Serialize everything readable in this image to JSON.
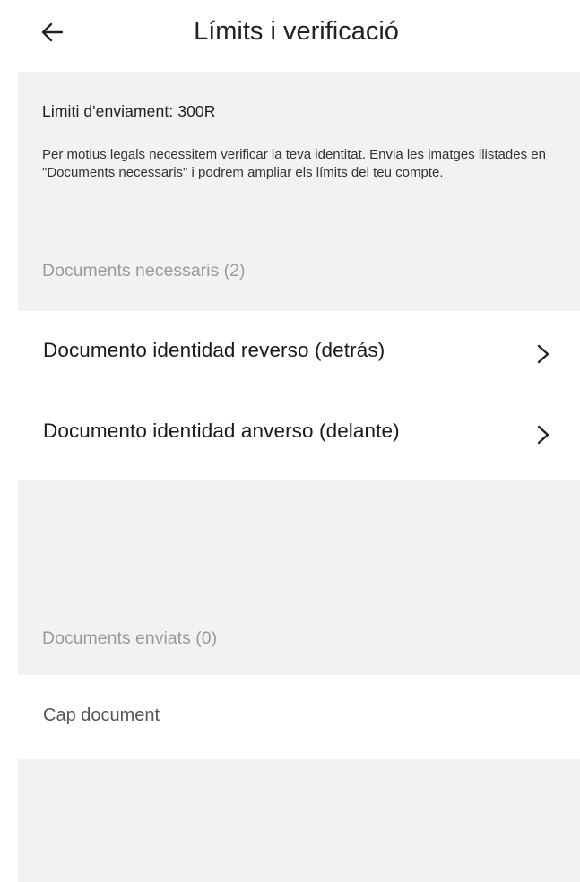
{
  "header": {
    "title": "Límits i verificació",
    "back_icon": "arrow-left-icon"
  },
  "info": {
    "limit_label": "Limiti d'enviament: 300R",
    "description": "Per motius legals necessitem verificar la teva identitat. Envia les imatges llistades en \"Documents necessaris\" i podrem ampliar els límits del teu compte."
  },
  "required_docs": {
    "header": "Documents necessaris (2)",
    "items": [
      {
        "label": "Documento identidad reverso (detrás)",
        "icon": "chevron-right-icon"
      },
      {
        "label": "Documento identidad anverso (delante)",
        "icon": "chevron-right-icon"
      }
    ]
  },
  "sent_docs": {
    "header": "Documents enviats (0)",
    "empty_text": "Cap document"
  },
  "colors": {
    "section_background": "#f2f2f2",
    "text_primary": "#1a1a1a",
    "text_muted": "#9a9a9a"
  }
}
